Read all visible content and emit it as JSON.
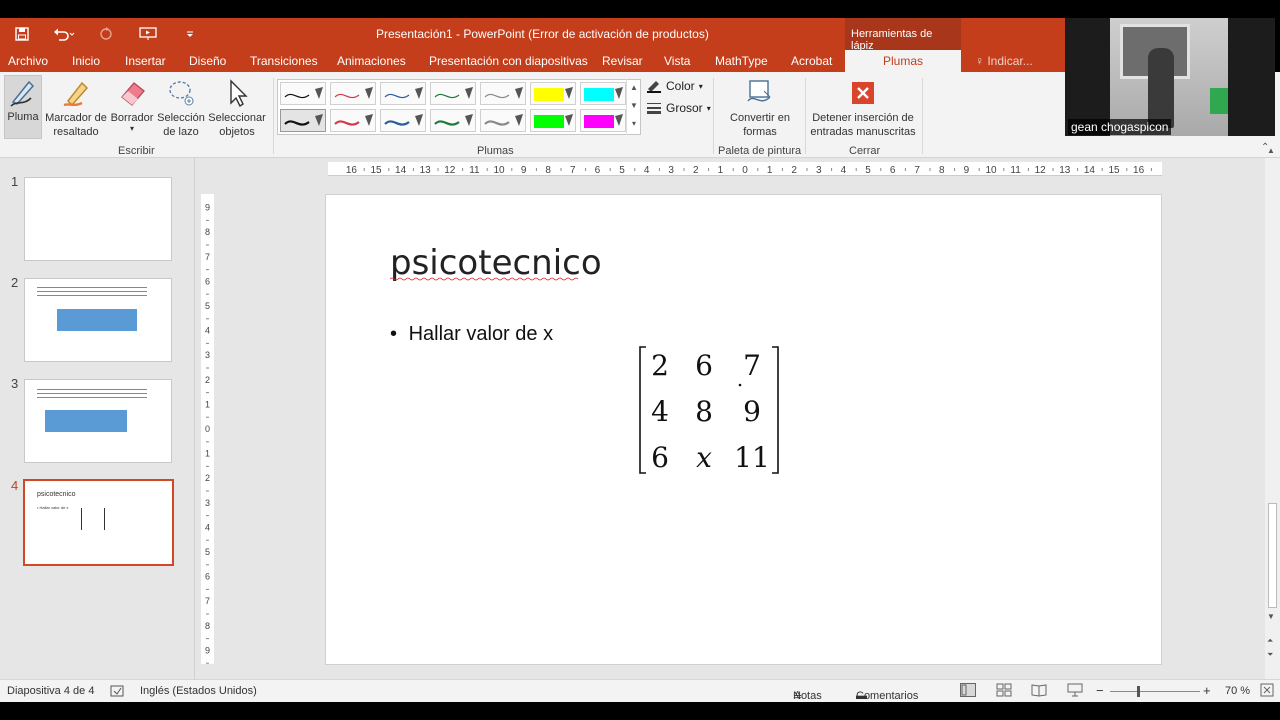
{
  "app": {
    "title": "Presentación1 - PowerPoint (Error de activación de productos)",
    "contextual_tab": "Herramientas de lápiz"
  },
  "tabs": [
    "Archivo",
    "Inicio",
    "Insertar",
    "Diseño",
    "Transiciones",
    "Animaciones",
    "Presentación con diapositivas",
    "Revisar",
    "Vista",
    "MathType",
    "Acrobat"
  ],
  "active_tab": "Plumas",
  "tell_me": "Indicar...",
  "ribbon": {
    "escribir": {
      "label": "Escribir",
      "pluma": "Pluma",
      "marcador": "Marcador de resaltado",
      "borrador": "Borrador",
      "lazo": "Selección de lazo",
      "seleccionar": "Seleccionar objetos"
    },
    "plumas": {
      "label": "Plumas",
      "color": "Color",
      "grosor": "Grosor"
    },
    "paleta": {
      "label": "Paleta de pintura",
      "convertir": "Convertir en formas"
    },
    "cerrar": {
      "label": "Cerrar",
      "detener": "Detener inserción de entradas manuscritas"
    },
    "colors": {
      "accent": "#c43e1c",
      "yellow": "#ffff00",
      "cyan": "#00ffff",
      "green": "#00ff00",
      "magenta": "#ff00ff"
    }
  },
  "webcam": {
    "name": "gean chogaspicon"
  },
  "thumbnails": [
    {
      "num": "1"
    },
    {
      "num": "2"
    },
    {
      "num": "3"
    },
    {
      "num": "4",
      "title": "psicotecnico",
      "bullet": "• Hallar valor de x"
    }
  ],
  "slide": {
    "title": "psicotecnico",
    "bullet": "Hallar valor de x",
    "matrix": [
      [
        "2",
        "6",
        "7"
      ],
      [
        "4",
        "8",
        "9"
      ],
      [
        "6",
        "x",
        "11"
      ]
    ]
  },
  "status": {
    "slide_info": "Diapositiva 4 de 4",
    "language": "Inglés (Estados Unidos)",
    "notes": "Notas",
    "comments": "Comentarios",
    "zoom": "70 %"
  }
}
